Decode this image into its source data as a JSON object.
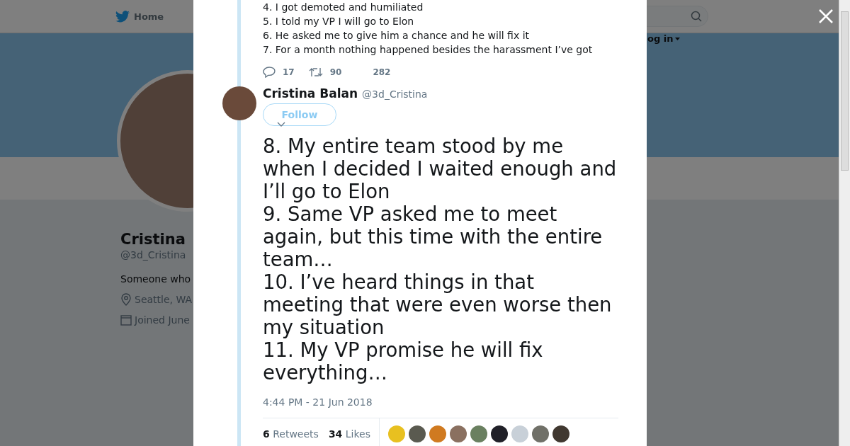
{
  "nav": {
    "home": "Home",
    "login": "og in"
  },
  "profile": {
    "name": "Cristina",
    "handle": "@3d_Cristina",
    "bio": "Someone who",
    "location": "Seattle, WA",
    "joined": "Joined June"
  },
  "previous_tweet": {
    "lines": [
      "4. I got demoted and humiliated",
      "5. I told my VP I will go to Elon",
      "6. He asked me to give him a chance and he will fix it",
      "7. For a month nothing happened besides the harassment I’ve got"
    ],
    "replies": "17",
    "retweets": "90",
    "likes": "282"
  },
  "tweet": {
    "name": "Cristina Balan",
    "handle": "@3d_Cristina",
    "follow": "Follow",
    "text": "8. My entire team stood by me when I decided I waited enough and I’ll go to Elon\n9. Same VP asked me to meet again, but this time with the entire team…\n10. I’ve heard things in that meeting that were even worse then my situation\n11. My VP promise he will fix everything…",
    "time": "4:44 PM - 21 Jun 2018",
    "retweet_count": "6",
    "retweet_label": "Retweets",
    "like_count": "34",
    "like_label": "Likes",
    "likers": [
      {
        "color": "#e8c020"
      },
      {
        "color": "#5a5a50"
      },
      {
        "color": "#d07a20"
      },
      {
        "color": "#8a7060"
      },
      {
        "color": "#6a8060"
      },
      {
        "color": "#202028"
      },
      {
        "color": "#c8d0d8"
      },
      {
        "color": "#707068"
      },
      {
        "color": "#403830"
      }
    ]
  }
}
